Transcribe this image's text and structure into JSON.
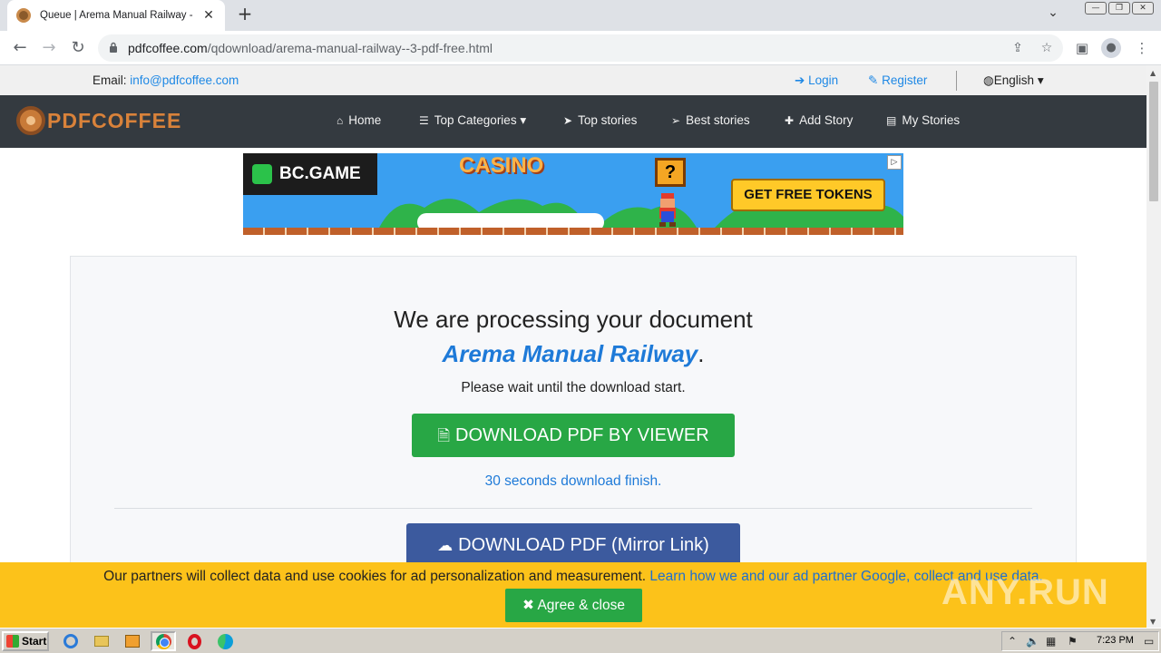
{
  "browser": {
    "tab_title": "Queue | Arema Manual Railway - PDF",
    "tab_close": "✕",
    "new_tab": "+",
    "url_host": "pdfcoffee.com",
    "url_path": "/qdownload/arema-manual-railway--3-pdf-free.html"
  },
  "topbar": {
    "email_label": "Email: ",
    "email": "info@pdfcoffee.com",
    "login": "Login",
    "register": "Register",
    "language": "English"
  },
  "navbar": {
    "logo": "PDFCOFFEE",
    "items": [
      {
        "label": "Home",
        "icon": "home-icon"
      },
      {
        "label": "Top Categories",
        "icon": "list-icon"
      },
      {
        "label": "Top stories",
        "icon": "paper-plane-icon"
      },
      {
        "label": "Best stories",
        "icon": "paper-plane-icon"
      },
      {
        "label": "Add Story",
        "icon": "plus-icon"
      },
      {
        "label": "My Stories",
        "icon": "file-icon"
      }
    ]
  },
  "ad": {
    "brand": "BC.GAME",
    "headline": "CASINO",
    "block": "?",
    "cta": "GET FREE TOKENS"
  },
  "main": {
    "processing": "We are processing your document",
    "document_title": "Arema Manual Railway",
    "document_suffix": ".",
    "wait": "Please wait until the download start.",
    "viewer_button": "DOWNLOAD PDF BY VIEWER",
    "countdown": "30 seconds download finish.",
    "mirror_button": "DOWNLOAD PDF (Mirror Link)"
  },
  "cookie": {
    "text": "Our partners will collect data and use cookies for ad personalization and measurement.",
    "link": "Learn how we and our ad partner Google, collect and use data.",
    "agree": "Agree & close"
  },
  "watermark": "ANY.RUN",
  "taskbar": {
    "start": "Start",
    "clock": "7:23 PM"
  },
  "colors": {
    "navbar_bg": "#343a40",
    "link_blue": "#1e88e5",
    "green_button": "#28a745",
    "mirror_button": "#3c5a9e",
    "cookie_bar": "#fcc21a",
    "logo_orange": "#d9823a"
  }
}
